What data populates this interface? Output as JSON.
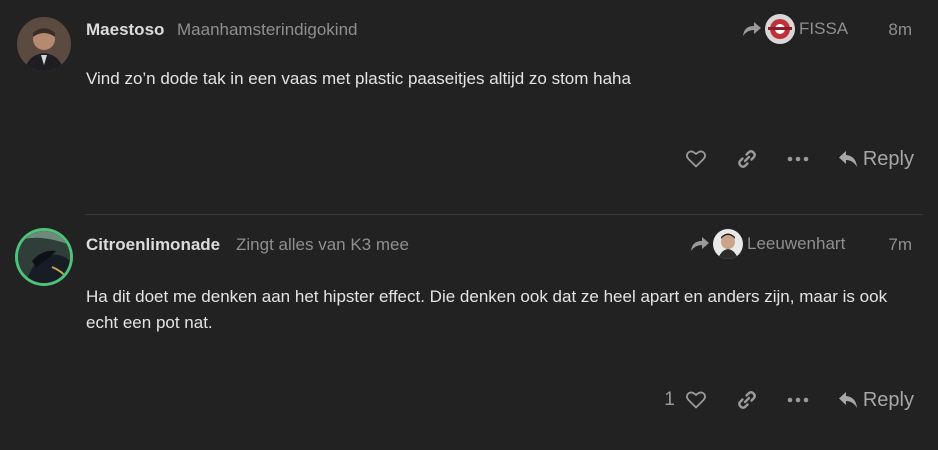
{
  "posts": [
    {
      "username": "Maestoso",
      "user_title": "Maanhamsterindigokind",
      "reply_to": "FISSA",
      "time": "8m",
      "text": "Vind zo’n dode tak in een vaas met plastic paaseitjes altijd zo stom haha",
      "likes": "",
      "reply_label": "Reply"
    },
    {
      "username": "Citroenlimonade",
      "user_title": "Zingt alles van K3 mee",
      "reply_to": "Leeuwenhart",
      "time": "7m",
      "text": "Ha dit doet me denken aan het hipster effect. Die denken ook dat ze heel apart en anders zijn, maar is ook echt een pot nat.",
      "likes": "1",
      "reply_label": "Reply"
    }
  ],
  "colors": {
    "background": "#222222",
    "username": "#dcdcdc",
    "muted": "#8f8f8f",
    "avatar_ring": "#4ec27a"
  }
}
